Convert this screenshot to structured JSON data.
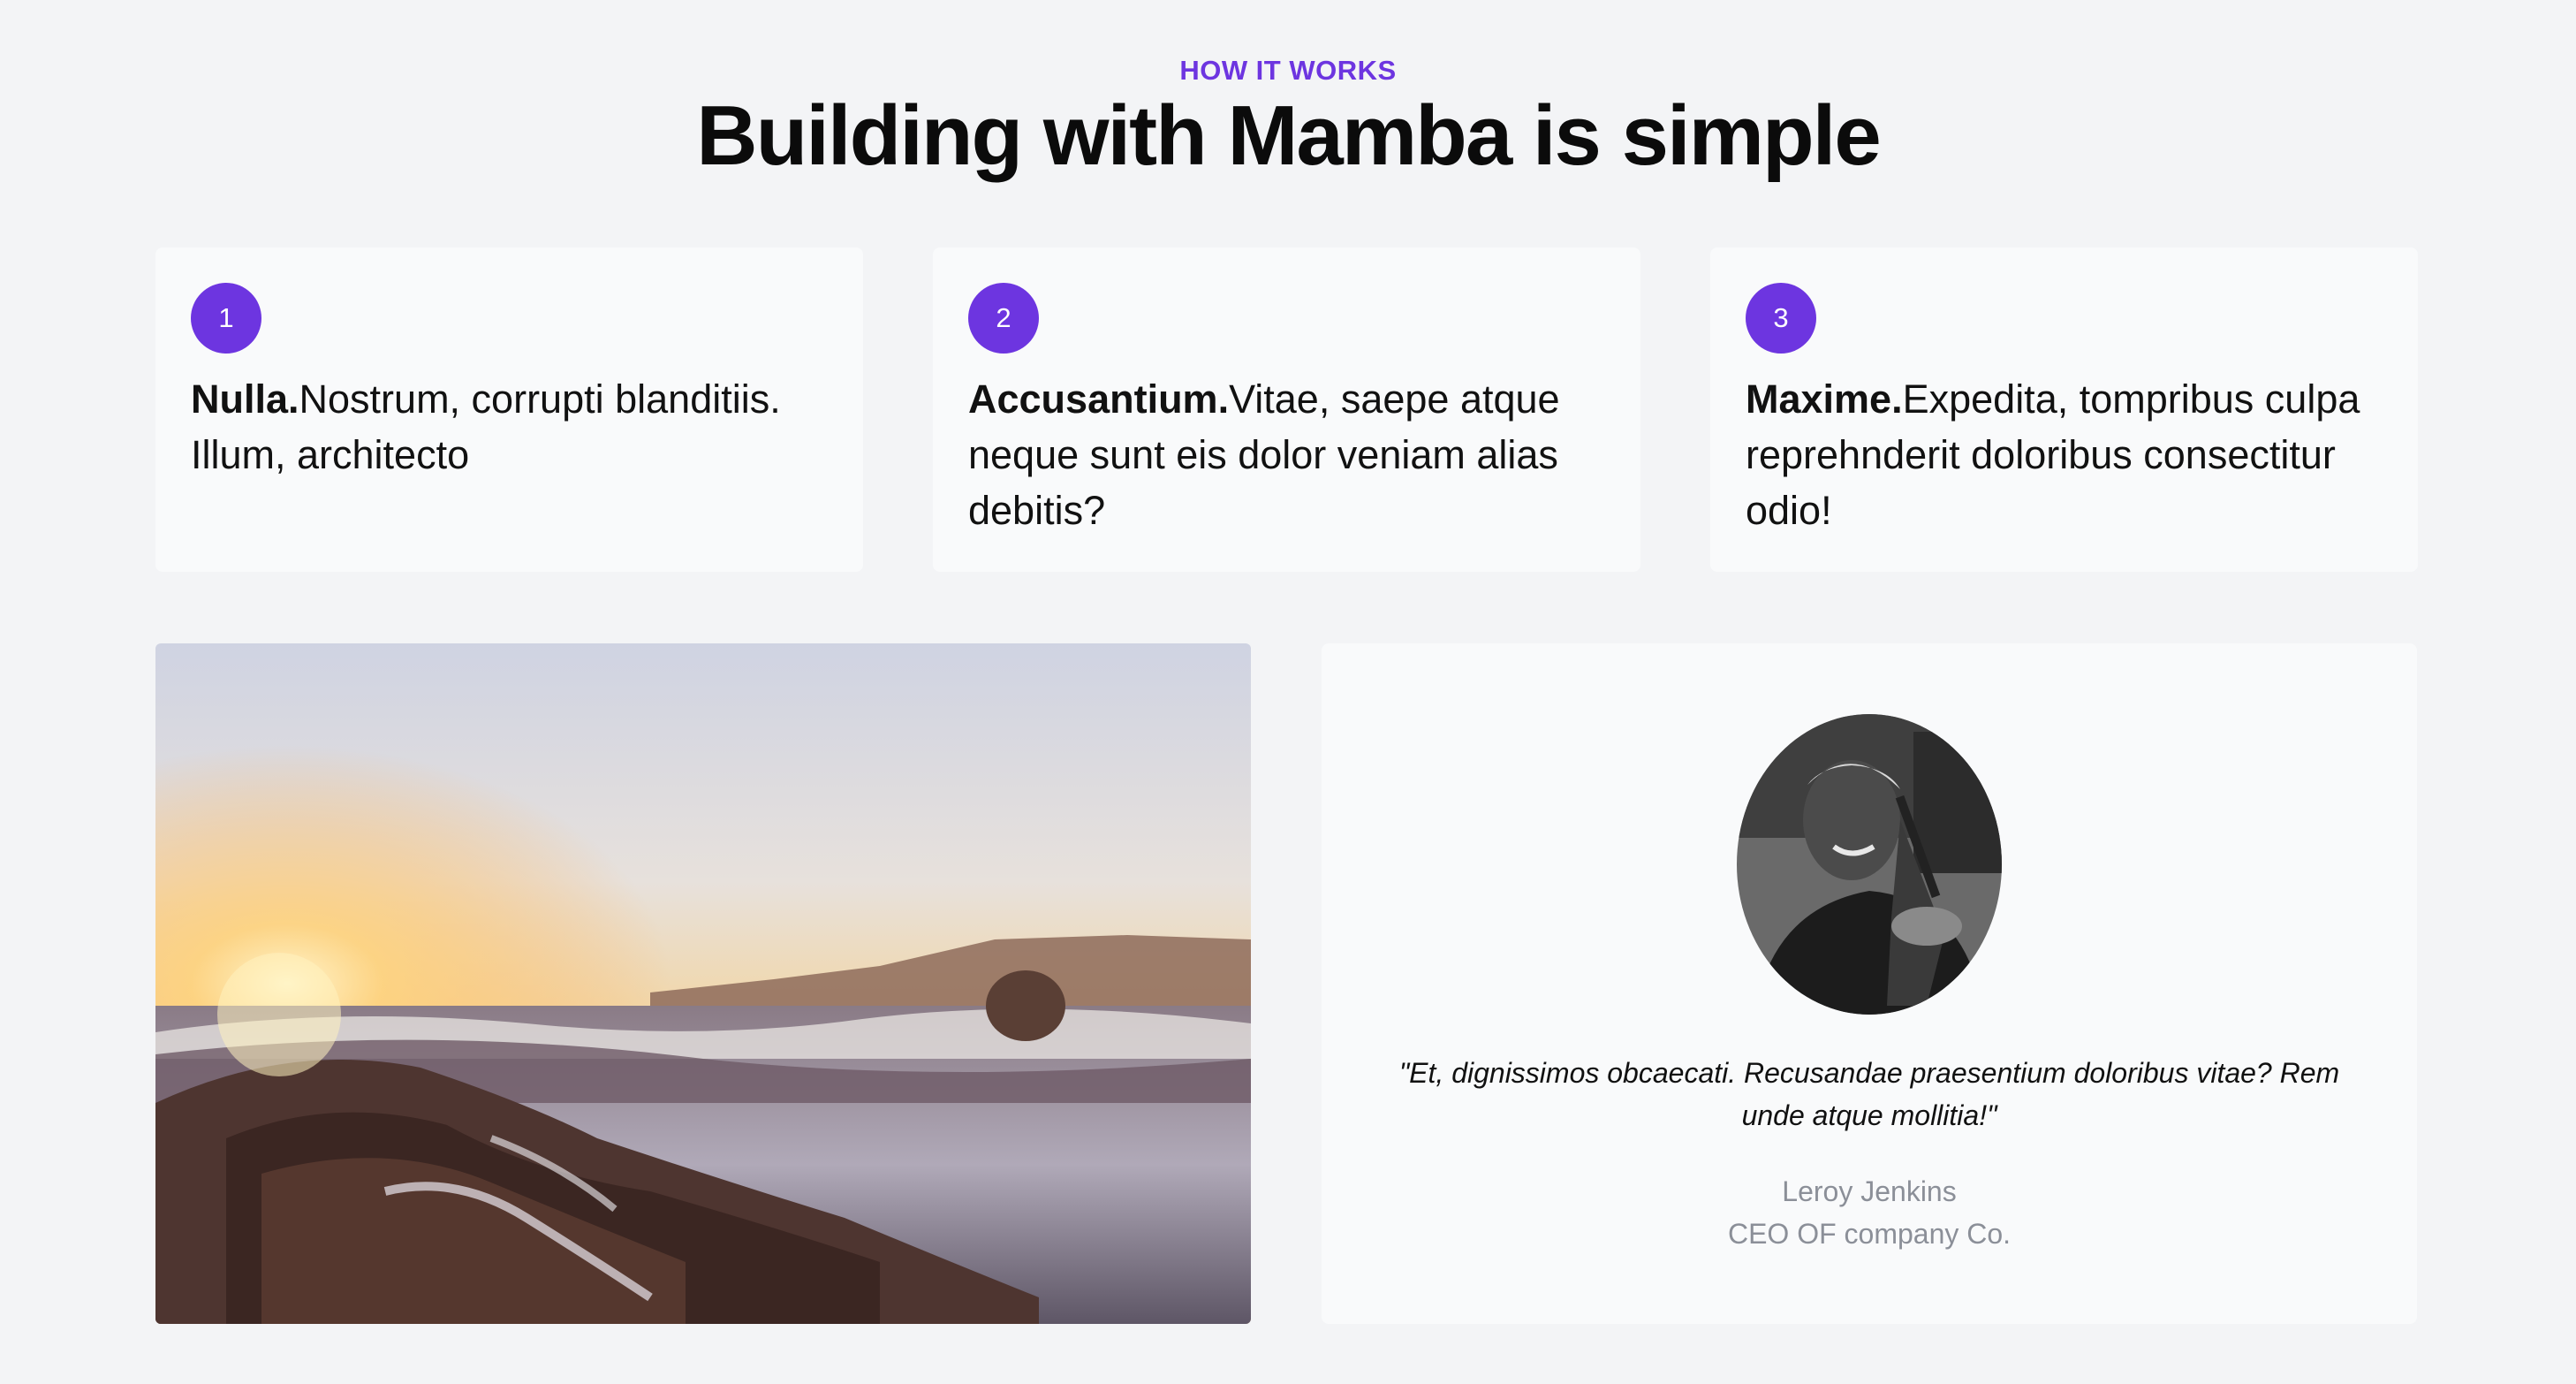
{
  "section": {
    "eyebrow": "HOW IT WORKS",
    "title": "Building with Mamba is simple"
  },
  "steps": [
    {
      "number": "1",
      "bold": "Nulla.",
      "text": "Nostrum, corrupti blanditiis. Illum, architecto"
    },
    {
      "number": "2",
      "bold": "Accusantium.",
      "text": "Vitae, saepe atque neque sunt eis dolor veniam alias debitis?"
    },
    {
      "number": "3",
      "bold": "Maxime.",
      "text": "Expedita, tompribus culpa reprehnderit doloribus consectitur odio!"
    }
  ],
  "testimonial": {
    "quote": "\"Et, dignissimos obcaecati. Recusandae praesentium doloribus vitae? Rem unde atque mollitia!\"",
    "name": "Leroy Jenkins",
    "role": "CEO OF company Co."
  },
  "colors": {
    "accent": "#6d35e0",
    "background": "#f3f4f6",
    "card": "#f9fafb",
    "muted_text": "#8b8f98"
  }
}
